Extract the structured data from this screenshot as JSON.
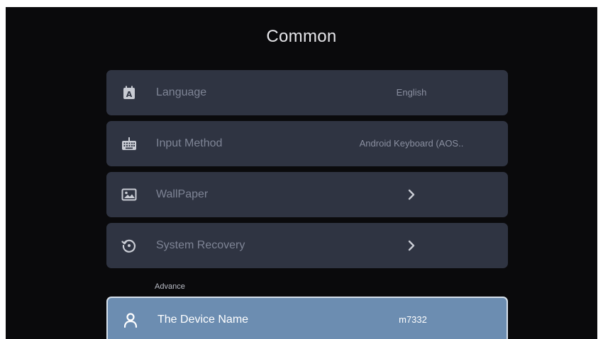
{
  "page": {
    "title": "Common"
  },
  "items": [
    {
      "label": "Language",
      "value": "English",
      "icon": "language-icon"
    },
    {
      "label": "Input Method",
      "value": "Android Keyboard (AOS..",
      "icon": "keyboard-icon"
    },
    {
      "label": "WallPaper",
      "value": "",
      "icon": "image-icon"
    },
    {
      "label": "System Recovery",
      "value": "",
      "icon": "restore-icon"
    }
  ],
  "advance": {
    "section_label": "Advance",
    "device_name": {
      "label": "The Device Name",
      "value": "m7332",
      "icon": "person-icon"
    }
  },
  "colors": {
    "background": "#0a0a0c",
    "row": "#2f3442",
    "selected_row": "#6c8db1",
    "selected_border": "#d7e1ec"
  }
}
